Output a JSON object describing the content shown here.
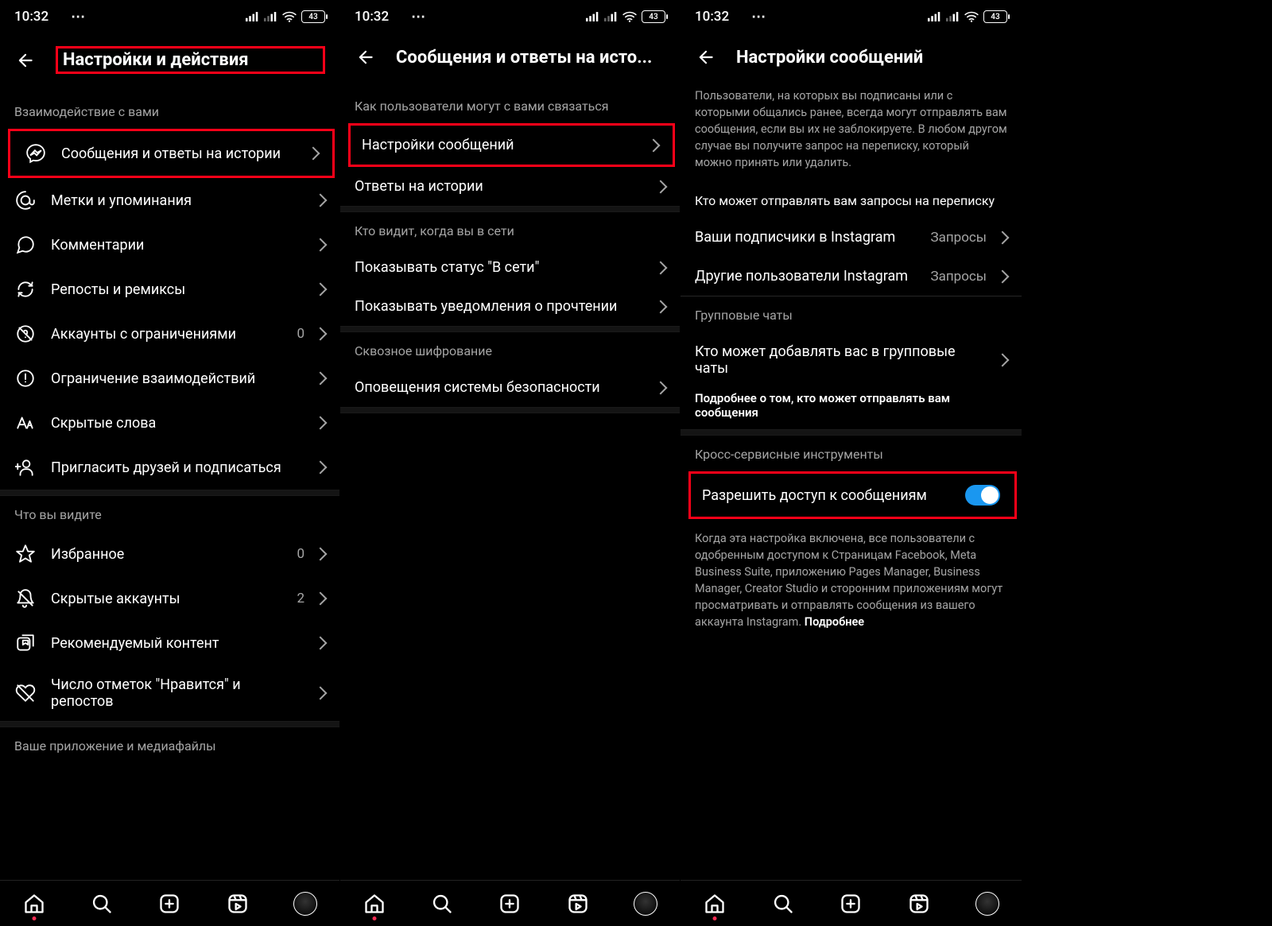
{
  "status": {
    "time": "10:32",
    "battery": "43"
  },
  "pane1": {
    "title": "Настройки и действия",
    "section1": "Взаимодействие с вами",
    "items1": [
      {
        "label": "Сообщения и ответы на истории",
        "icon": "messenger"
      },
      {
        "label": "Метки и упоминания",
        "icon": "mention"
      },
      {
        "label": "Комментарии",
        "icon": "comment"
      },
      {
        "label": "Репосты и ремиксы",
        "icon": "repost"
      },
      {
        "label": "Аккаунты с ограничениями",
        "icon": "restrict",
        "value": "0"
      },
      {
        "label": "Ограничение взаимодействий",
        "icon": "limit"
      },
      {
        "label": "Скрытые слова",
        "icon": "aa"
      },
      {
        "label": "Пригласить друзей и подписаться",
        "icon": "invite"
      }
    ],
    "section2": "Что вы видите",
    "items2": [
      {
        "label": "Избранное",
        "icon": "star",
        "value": "0"
      },
      {
        "label": "Скрытые аккаунты",
        "icon": "mute",
        "value": "2"
      },
      {
        "label": "Рекомендуемый контент",
        "icon": "reco"
      },
      {
        "label": "Число отметок \"Нравится\" и репостов",
        "icon": "heartoff"
      }
    ],
    "section3": "Ваше приложение и медиафайлы"
  },
  "pane2": {
    "title": "Сообщения и ответы на исто...",
    "section1": "Как пользователи могут с вами связаться",
    "items1": [
      {
        "label": "Настройки сообщений"
      },
      {
        "label": "Ответы на истории"
      }
    ],
    "section2": "Кто видит, когда вы в сети",
    "items2": [
      {
        "label": "Показывать статус \"В сети\""
      },
      {
        "label": "Показывать уведомления о прочтении"
      }
    ],
    "section3": "Сквозное шифрование",
    "items3": [
      {
        "label": "Оповещения системы безопасности"
      }
    ]
  },
  "pane3": {
    "title": "Настройки сообщений",
    "intro": "Пользователи, на которых вы подписаны или с которыми общались ранее, всегда могут отправлять вам сообщения, если вы их не заблокируете. В любом другом случае вы получите запрос на переписку, который можно принять или удалить.",
    "section1": "Кто может отправлять вам запросы на переписку",
    "items1": [
      {
        "label": "Ваши подписчики в Instagram",
        "value": "Запросы"
      },
      {
        "label": "Другие пользователи Instagram",
        "value": "Запросы"
      }
    ],
    "section2": "Групповые чаты",
    "items2": [
      {
        "label": "Кто может добавлять вас в групповые чаты"
      }
    ],
    "sub2": "Подробнее о том, кто может отправлять вам сообщения",
    "section3": "Кросс-сервисные инструменты",
    "toggleLabel": "Разрешить доступ к сообщениям",
    "outro": "Когда эта настройка включена, все пользователи с одобренным доступом к Страницам Facebook, Meta Business Suite, приложению Pages Manager, Business Manager, Creator Studio и сторонним приложениям могут просматривать и отправлять сообщения из вашего аккаунта Instagram.",
    "more": "Подробнее"
  }
}
